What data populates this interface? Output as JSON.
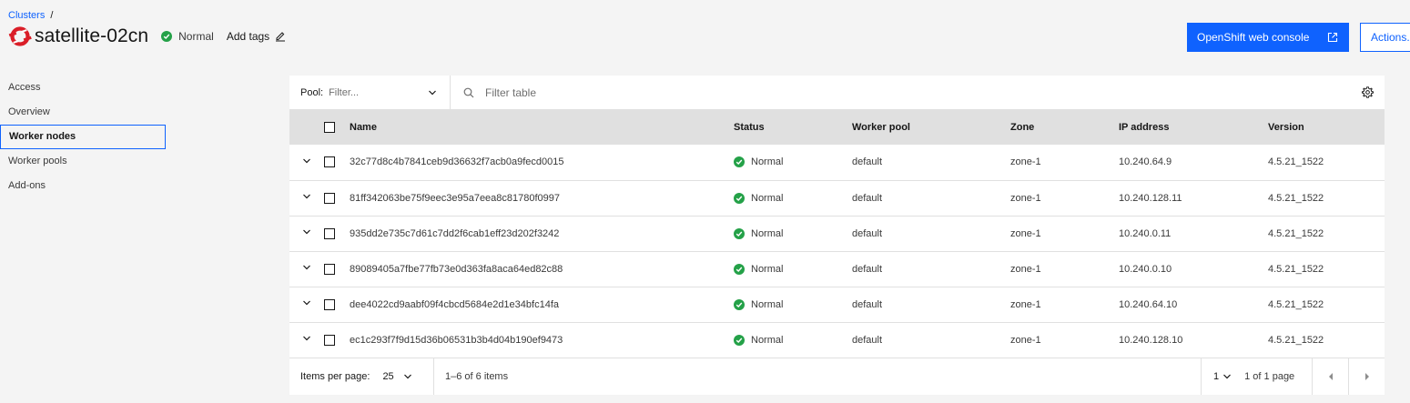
{
  "breadcrumb": {
    "link": "Clusters",
    "separator": "/"
  },
  "header": {
    "title": "satellite-02cn",
    "status": "Normal",
    "add_tags": "Add tags",
    "primary_button": "OpenShift web console",
    "secondary_button": "Actions..."
  },
  "sidebar": {
    "items": [
      {
        "label": "Access"
      },
      {
        "label": "Overview"
      },
      {
        "label": "Worker nodes",
        "active": true
      },
      {
        "label": "Worker pools"
      },
      {
        "label": "Add-ons"
      }
    ]
  },
  "toolbar": {
    "pool_label": "Pool:",
    "pool_placeholder": "Filter...",
    "search_placeholder": "Filter table"
  },
  "table": {
    "columns": [
      "Name",
      "Status",
      "Worker pool",
      "Zone",
      "IP address",
      "Version"
    ],
    "rows": [
      {
        "name": "32c77d8c4b7841ceb9d36632f7acb0a9fecd0015",
        "status": "Normal",
        "pool": "default",
        "zone": "zone-1",
        "ip": "10.240.64.9",
        "version": "4.5.21_1522"
      },
      {
        "name": "81ff342063be75f9eec3e95a7eea8c81780f0997",
        "status": "Normal",
        "pool": "default",
        "zone": "zone-1",
        "ip": "10.240.128.11",
        "version": "4.5.21_1522"
      },
      {
        "name": "935dd2e735c7d61c7dd2f6cab1eff23d202f3242",
        "status": "Normal",
        "pool": "default",
        "zone": "zone-1",
        "ip": "10.240.0.11",
        "version": "4.5.21_1522"
      },
      {
        "name": "89089405a7fbe77fb73e0d363fa8aca64ed82c88",
        "status": "Normal",
        "pool": "default",
        "zone": "zone-1",
        "ip": "10.240.0.10",
        "version": "4.5.21_1522"
      },
      {
        "name": "dee4022cd9aabf09f4cbcd5684e2d1e34bfc14fa",
        "status": "Normal",
        "pool": "default",
        "zone": "zone-1",
        "ip": "10.240.64.10",
        "version": "4.5.21_1522"
      },
      {
        "name": "ec1c293f7f9d15d36b06531b3b4d04b190ef9473",
        "status": "Normal",
        "pool": "default",
        "zone": "zone-1",
        "ip": "10.240.128.10",
        "version": "4.5.21_1522"
      }
    ]
  },
  "pagination": {
    "items_per_page_label": "Items per page:",
    "items_per_page": "25",
    "range": "1–6 of 6 items",
    "page": "1",
    "of_pages": "1 of 1 page"
  },
  "colors": {
    "accent": "#0f62fe",
    "success": "#24a148",
    "logo": "#da1e28"
  }
}
